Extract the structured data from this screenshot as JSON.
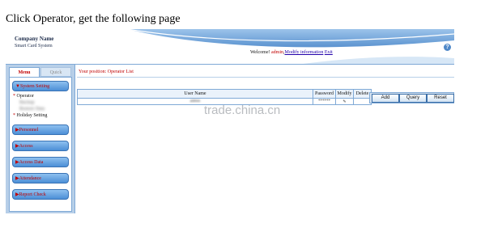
{
  "caption": "Click Operator, get the following page",
  "header": {
    "company_name": "Company Name",
    "system_name": "Smart Card System",
    "welcome_text": "Welcome!",
    "user": "admin",
    "modify_link": "Modify information",
    "exit_link": "Exit",
    "help_glyph": "?"
  },
  "sidebar": {
    "tabs": [
      "Menu",
      "Quick"
    ],
    "buttons": [
      "▼System Setting",
      "▶Personnel",
      "▶Access",
      "▶Access Data",
      "▶Attendance",
      "▶Report Check"
    ],
    "sub_items": [
      "Operator",
      "Holiday Setting"
    ],
    "blurred_items": [
      "Backup",
      "Restore Data"
    ]
  },
  "content": {
    "position": "Your position: Operator List",
    "table_headers": [
      "User Name",
      "Password",
      "Modify",
      "Delete"
    ],
    "row": [
      "admin",
      "******",
      "✎",
      ""
    ],
    "actions": [
      "Add",
      "Query",
      "Reset"
    ]
  },
  "watermark": "trade.china.cn",
  "colors": {
    "accent": "#c00000",
    "border": "#7fa9d6",
    "button_top": "#8ec0ef",
    "button_bottom": "#4c8fd6"
  },
  "icons": {
    "help": "help-circle-icon",
    "edit": "pencil-icon"
  }
}
